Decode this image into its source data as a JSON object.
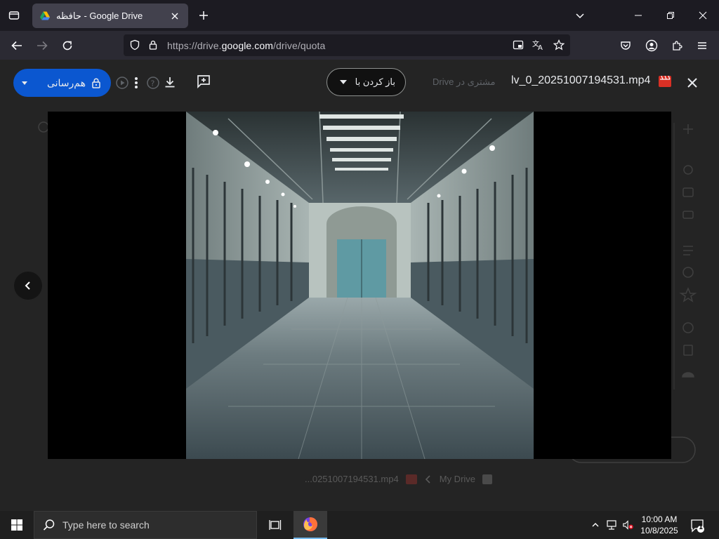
{
  "browser": {
    "tab_title": "حافظه - Google Drive",
    "url_prefix": "https://drive.",
    "url_host": "google.com",
    "url_path": "/drive/quota"
  },
  "viewer": {
    "share_label": "هم‌رسانی",
    "open_with_label": "باز کردن با",
    "location_ghost": "مشتری در Drive",
    "file_name": "lv_0_20251007194531.mp4",
    "bottom_file": "...0251007194531.mp4",
    "bottom_location": "My Drive"
  },
  "taskbar": {
    "search_placeholder": "Type here to search",
    "time": "10:00 AM",
    "date": "10/8/2025",
    "notification_count": "1"
  },
  "colors": {
    "share_blue": "#0b57d0",
    "tab_bg": "#42414d",
    "nav_bg": "#2b2a33",
    "taskbar_bg": "#1f1f1f"
  }
}
